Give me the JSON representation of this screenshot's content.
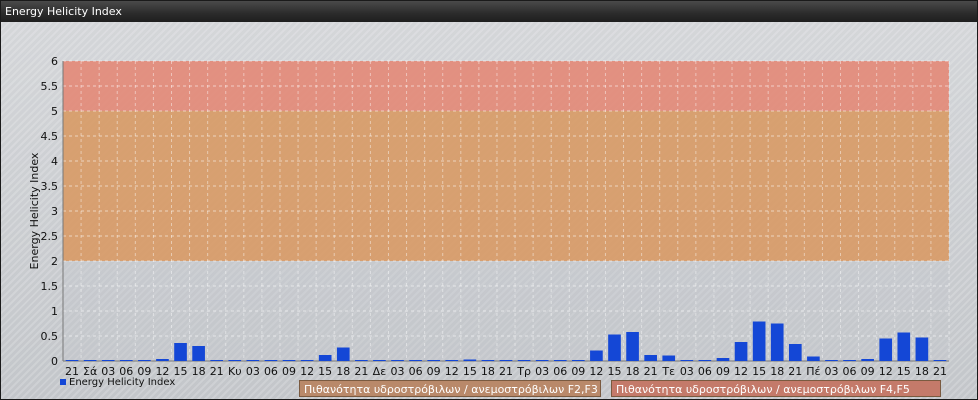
{
  "window": {
    "title": "Energy Helicity Index"
  },
  "legend": {
    "series_label": "Energy Helicity Index",
    "zone1_label": "Πιθανότητα υδροστρόβιλων / ανεμοστρόβιλων F2,F3",
    "zone2_label": "Πιθανότητα υδροστρόβιλων / ανεμοστρόβιλων F4,F5"
  },
  "colors": {
    "bar": "#1447d6",
    "zone_low": "#d9985f",
    "zone_mid": "#e6a060",
    "zone_high": "#e58572",
    "zone1_legend": "#b9896a",
    "zone2_legend": "#c47a6a"
  },
  "chart_data": {
    "type": "bar",
    "ylabel": "Energy Helicity Index",
    "ylim": [
      0,
      6
    ],
    "yticks": [
      0,
      0.5,
      1,
      1.5,
      2,
      2.5,
      3,
      3.5,
      4,
      4.5,
      5,
      5.5,
      6
    ],
    "grid": true,
    "categories": [
      "21",
      "Σά",
      "03",
      "06",
      "09",
      "12",
      "15",
      "18",
      "21",
      "Κυ",
      "03",
      "06",
      "09",
      "12",
      "15",
      "18",
      "21",
      "Δε",
      "03",
      "06",
      "09",
      "12",
      "15",
      "18",
      "21",
      "Τρ",
      "03",
      "06",
      "09",
      "12",
      "15",
      "18",
      "21",
      "Τε",
      "03",
      "06",
      "09",
      "12",
      "15",
      "18",
      "21",
      "Πέ",
      "03",
      "06",
      "09",
      "12",
      "15",
      "18",
      "21"
    ],
    "series": [
      {
        "name": "Energy Helicity Index",
        "values": [
          0.02,
          0.01,
          0.01,
          0.01,
          0.01,
          0.04,
          0.36,
          0.3,
          0.01,
          0.01,
          0.01,
          0.01,
          0.01,
          0.02,
          0.12,
          0.27,
          0.01,
          0.01,
          0.01,
          0.01,
          0.01,
          0.01,
          0.03,
          0.02,
          0.02,
          0.02,
          0.01,
          0.01,
          0.02,
          0.21,
          0.53,
          0.58,
          0.12,
          0.11,
          0.01,
          0.01,
          0.06,
          0.38,
          0.79,
          0.75,
          0.34,
          0.09,
          0.02,
          0.01,
          0.04,
          0.45,
          0.57,
          0.47,
          0.02
        ]
      }
    ],
    "zones": [
      {
        "from": 2,
        "to": 5,
        "label_ref": "zone1_label"
      },
      {
        "from": 5,
        "to": 6,
        "label_ref": "zone2_label"
      }
    ]
  }
}
